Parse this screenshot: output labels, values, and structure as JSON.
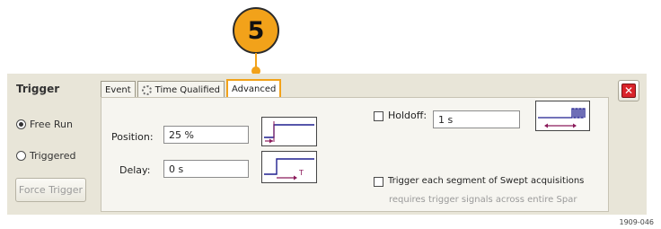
{
  "callout": {
    "number": "5"
  },
  "trigger": {
    "title": "Trigger",
    "free_run_label": "Free Run",
    "triggered_label": "Triggered",
    "force_trigger_label": "Force Trigger",
    "selected_mode": "Free Run"
  },
  "tabs": [
    {
      "label": "Event"
    },
    {
      "label": "Time Qualified",
      "icon": "gear-icon"
    },
    {
      "label": "Advanced",
      "active": true
    }
  ],
  "advanced": {
    "position_label": "Position:",
    "position_value": "25 %",
    "delay_label": "Delay:",
    "delay_value": "0 s",
    "holdoff_label": "Holdoff:",
    "holdoff_value": "1 s",
    "holdoff_checked": false,
    "segment_label": "Trigger each segment of Swept acquisitions",
    "segment_checked": false,
    "segment_note": "requires trigger signals across entire Spar"
  },
  "figure_id": "1909-046",
  "colors": {
    "accent": "#f2a21a",
    "panel": "#e8e5d8",
    "close": "#d9232a",
    "diagram_line": "#1f1f8f",
    "diagram_arrow": "#8b1a5a"
  }
}
